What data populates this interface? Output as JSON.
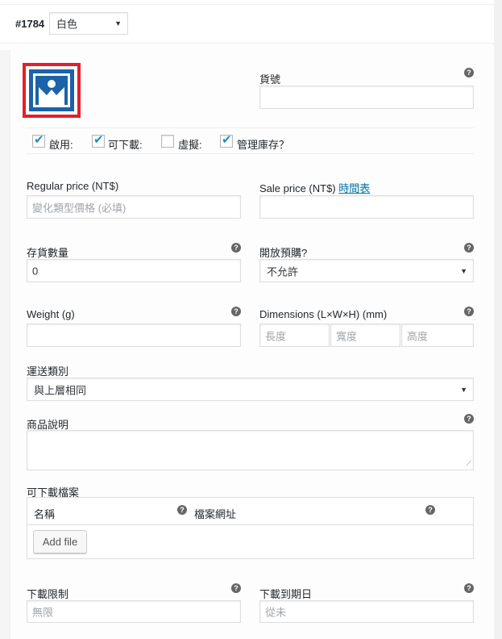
{
  "variation": {
    "id": "#1784",
    "attribute_value": "白色"
  },
  "fields": {
    "sku": {
      "label": "貨號",
      "value": ""
    },
    "options": {
      "enabled": {
        "label": "啟用:",
        "checked": true
      },
      "downloadable": {
        "label": "可下載:",
        "checked": true
      },
      "virtual": {
        "label": "虛擬:",
        "checked": false
      },
      "manage_stock": {
        "label": "管理庫存？",
        "checked": true
      }
    },
    "regular_price": {
      "label": "Regular price (NT$)",
      "placeholder": "變化類型價格 (必填)"
    },
    "sale_price": {
      "label": "Sale price (NT$)",
      "schedule_link": "時間表",
      "value": ""
    },
    "stock_qty": {
      "label": "存貨數量",
      "value": "0"
    },
    "backorders": {
      "label": "開放預購?",
      "value": "不允許"
    },
    "weight": {
      "label": "Weight (g)",
      "value": ""
    },
    "dimensions": {
      "label": "Dimensions (L×W×H) (mm)",
      "length_placeholder": "長度",
      "width_placeholder": "寬度",
      "height_placeholder": "高度"
    },
    "shipping_class": {
      "label": "運送類別",
      "value": "與上層相同"
    },
    "description": {
      "label": "商品說明",
      "value": ""
    },
    "downloadable_files": {
      "label": "可下載檔案",
      "col_name": "名稱",
      "col_url": "檔案網址",
      "add_button": "Add file"
    },
    "download_limit": {
      "label": "下載限制",
      "placeholder": "無限"
    },
    "download_expiry": {
      "label": "下載到期日",
      "placeholder": "從未"
    }
  },
  "icons": {
    "help": "?",
    "dropdown": "▼",
    "checkmark": "✔",
    "resize": "⟋"
  },
  "colors": {
    "image_border": "#e3202b",
    "image_fill": "#1c62a8",
    "link": "#0073aa",
    "checkmark": "#1e8cbe"
  }
}
